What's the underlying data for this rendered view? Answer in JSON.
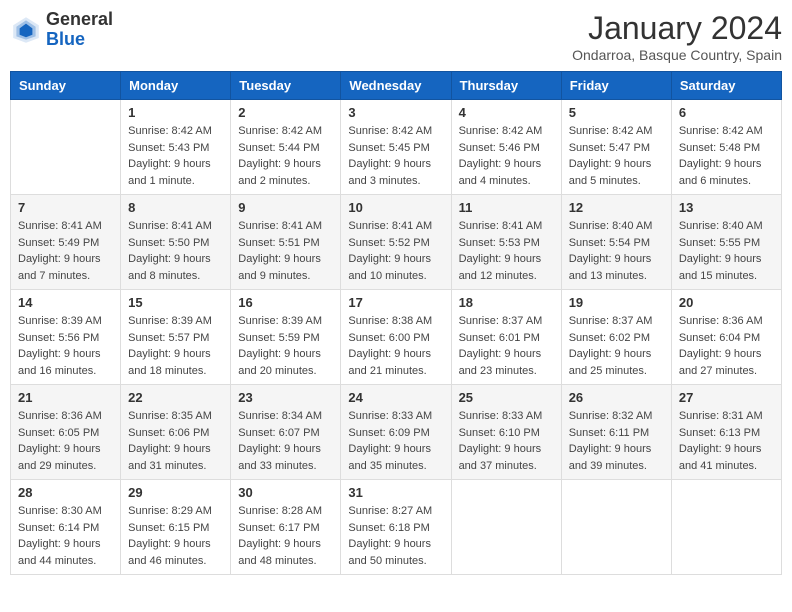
{
  "logo": {
    "general": "General",
    "blue": "Blue"
  },
  "header": {
    "month_title": "January 2024",
    "subtitle": "Ondarroa, Basque Country, Spain"
  },
  "weekdays": [
    "Sunday",
    "Monday",
    "Tuesday",
    "Wednesday",
    "Thursday",
    "Friday",
    "Saturday"
  ],
  "weeks": [
    [
      {
        "day": "",
        "sunrise": "",
        "sunset": "",
        "daylight": ""
      },
      {
        "day": "1",
        "sunrise": "Sunrise: 8:42 AM",
        "sunset": "Sunset: 5:43 PM",
        "daylight": "Daylight: 9 hours and 1 minute."
      },
      {
        "day": "2",
        "sunrise": "Sunrise: 8:42 AM",
        "sunset": "Sunset: 5:44 PM",
        "daylight": "Daylight: 9 hours and 2 minutes."
      },
      {
        "day": "3",
        "sunrise": "Sunrise: 8:42 AM",
        "sunset": "Sunset: 5:45 PM",
        "daylight": "Daylight: 9 hours and 3 minutes."
      },
      {
        "day": "4",
        "sunrise": "Sunrise: 8:42 AM",
        "sunset": "Sunset: 5:46 PM",
        "daylight": "Daylight: 9 hours and 4 minutes."
      },
      {
        "day": "5",
        "sunrise": "Sunrise: 8:42 AM",
        "sunset": "Sunset: 5:47 PM",
        "daylight": "Daylight: 9 hours and 5 minutes."
      },
      {
        "day": "6",
        "sunrise": "Sunrise: 8:42 AM",
        "sunset": "Sunset: 5:48 PM",
        "daylight": "Daylight: 9 hours and 6 minutes."
      }
    ],
    [
      {
        "day": "7",
        "sunrise": "Sunrise: 8:41 AM",
        "sunset": "Sunset: 5:49 PM",
        "daylight": "Daylight: 9 hours and 7 minutes."
      },
      {
        "day": "8",
        "sunrise": "Sunrise: 8:41 AM",
        "sunset": "Sunset: 5:50 PM",
        "daylight": "Daylight: 9 hours and 8 minutes."
      },
      {
        "day": "9",
        "sunrise": "Sunrise: 8:41 AM",
        "sunset": "Sunset: 5:51 PM",
        "daylight": "Daylight: 9 hours and 9 minutes."
      },
      {
        "day": "10",
        "sunrise": "Sunrise: 8:41 AM",
        "sunset": "Sunset: 5:52 PM",
        "daylight": "Daylight: 9 hours and 10 minutes."
      },
      {
        "day": "11",
        "sunrise": "Sunrise: 8:41 AM",
        "sunset": "Sunset: 5:53 PM",
        "daylight": "Daylight: 9 hours and 12 minutes."
      },
      {
        "day": "12",
        "sunrise": "Sunrise: 8:40 AM",
        "sunset": "Sunset: 5:54 PM",
        "daylight": "Daylight: 9 hours and 13 minutes."
      },
      {
        "day": "13",
        "sunrise": "Sunrise: 8:40 AM",
        "sunset": "Sunset: 5:55 PM",
        "daylight": "Daylight: 9 hours and 15 minutes."
      }
    ],
    [
      {
        "day": "14",
        "sunrise": "Sunrise: 8:39 AM",
        "sunset": "Sunset: 5:56 PM",
        "daylight": "Daylight: 9 hours and 16 minutes."
      },
      {
        "day": "15",
        "sunrise": "Sunrise: 8:39 AM",
        "sunset": "Sunset: 5:57 PM",
        "daylight": "Daylight: 9 hours and 18 minutes."
      },
      {
        "day": "16",
        "sunrise": "Sunrise: 8:39 AM",
        "sunset": "Sunset: 5:59 PM",
        "daylight": "Daylight: 9 hours and 20 minutes."
      },
      {
        "day": "17",
        "sunrise": "Sunrise: 8:38 AM",
        "sunset": "Sunset: 6:00 PM",
        "daylight": "Daylight: 9 hours and 21 minutes."
      },
      {
        "day": "18",
        "sunrise": "Sunrise: 8:37 AM",
        "sunset": "Sunset: 6:01 PM",
        "daylight": "Daylight: 9 hours and 23 minutes."
      },
      {
        "day": "19",
        "sunrise": "Sunrise: 8:37 AM",
        "sunset": "Sunset: 6:02 PM",
        "daylight": "Daylight: 9 hours and 25 minutes."
      },
      {
        "day": "20",
        "sunrise": "Sunrise: 8:36 AM",
        "sunset": "Sunset: 6:04 PM",
        "daylight": "Daylight: 9 hours and 27 minutes."
      }
    ],
    [
      {
        "day": "21",
        "sunrise": "Sunrise: 8:36 AM",
        "sunset": "Sunset: 6:05 PM",
        "daylight": "Daylight: 9 hours and 29 minutes."
      },
      {
        "day": "22",
        "sunrise": "Sunrise: 8:35 AM",
        "sunset": "Sunset: 6:06 PM",
        "daylight": "Daylight: 9 hours and 31 minutes."
      },
      {
        "day": "23",
        "sunrise": "Sunrise: 8:34 AM",
        "sunset": "Sunset: 6:07 PM",
        "daylight": "Daylight: 9 hours and 33 minutes."
      },
      {
        "day": "24",
        "sunrise": "Sunrise: 8:33 AM",
        "sunset": "Sunset: 6:09 PM",
        "daylight": "Daylight: 9 hours and 35 minutes."
      },
      {
        "day": "25",
        "sunrise": "Sunrise: 8:33 AM",
        "sunset": "Sunset: 6:10 PM",
        "daylight": "Daylight: 9 hours and 37 minutes."
      },
      {
        "day": "26",
        "sunrise": "Sunrise: 8:32 AM",
        "sunset": "Sunset: 6:11 PM",
        "daylight": "Daylight: 9 hours and 39 minutes."
      },
      {
        "day": "27",
        "sunrise": "Sunrise: 8:31 AM",
        "sunset": "Sunset: 6:13 PM",
        "daylight": "Daylight: 9 hours and 41 minutes."
      }
    ],
    [
      {
        "day": "28",
        "sunrise": "Sunrise: 8:30 AM",
        "sunset": "Sunset: 6:14 PM",
        "daylight": "Daylight: 9 hours and 44 minutes."
      },
      {
        "day": "29",
        "sunrise": "Sunrise: 8:29 AM",
        "sunset": "Sunset: 6:15 PM",
        "daylight": "Daylight: 9 hours and 46 minutes."
      },
      {
        "day": "30",
        "sunrise": "Sunrise: 8:28 AM",
        "sunset": "Sunset: 6:17 PM",
        "daylight": "Daylight: 9 hours and 48 minutes."
      },
      {
        "day": "31",
        "sunrise": "Sunrise: 8:27 AM",
        "sunset": "Sunset: 6:18 PM",
        "daylight": "Daylight: 9 hours and 50 minutes."
      },
      {
        "day": "",
        "sunrise": "",
        "sunset": "",
        "daylight": ""
      },
      {
        "day": "",
        "sunrise": "",
        "sunset": "",
        "daylight": ""
      },
      {
        "day": "",
        "sunrise": "",
        "sunset": "",
        "daylight": ""
      }
    ]
  ]
}
